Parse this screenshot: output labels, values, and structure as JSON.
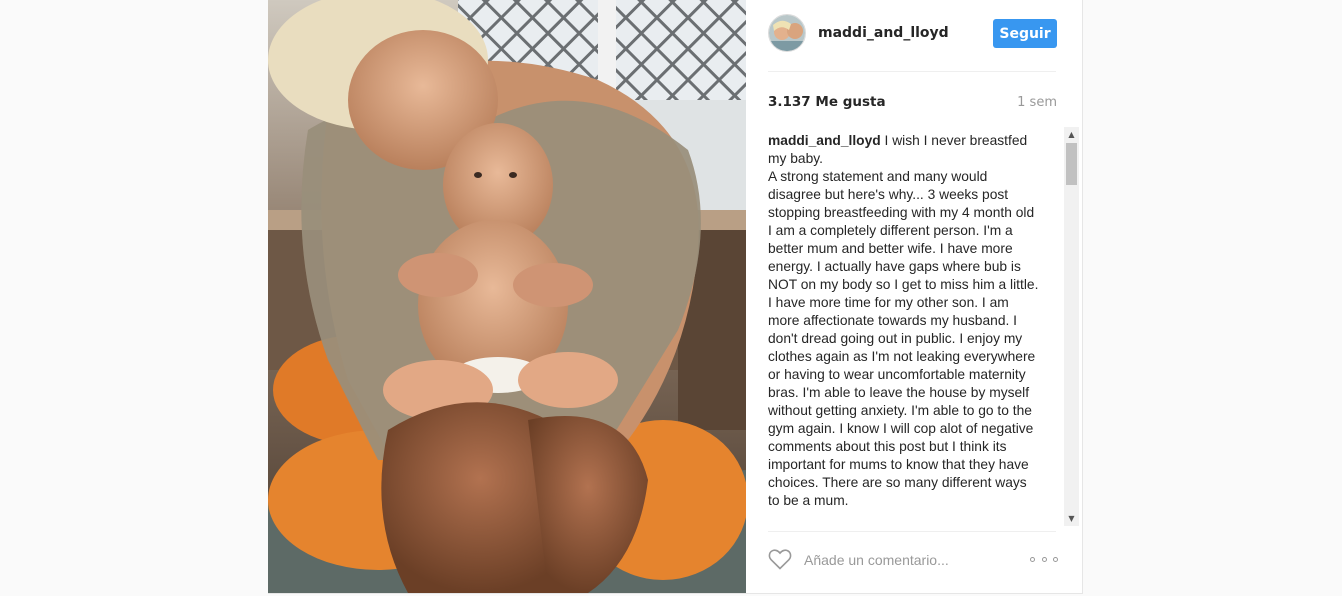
{
  "post": {
    "username": "maddi_and_lloyd",
    "follow_label": "Seguir",
    "likes": "3.137 Me gusta",
    "time": "1 sem",
    "caption_user": "maddi_and_lloyd",
    "caption_text": " I wish I never breastfed my baby.\nA strong statement and many would disagree but here's why... 3 weeks post stopping breastfeeding with my 4 month old I am a completely different person. I'm a better mum and better wife. I have more energy. I actually have gaps where bub is NOT on my body so I get to miss him a little. I have more time for my other son. I am more affectionate towards my husband. I don't dread going out in public. I enjoy my clothes again as I'm not leaking everywhere or having to wear uncomfortable maternity bras. I'm able to leave the house by myself without getting anxiety. I'm able to go to the gym again. I know I will cop alot of negative comments about this post but I think its important for mums to know that they have choices. There are so many different ways to be a mum.",
    "comment_placeholder": "Añade un comentario...",
    "icons": {
      "heart": "heart-icon",
      "more": "more-options-icon",
      "scroll_up": "▲",
      "scroll_down": "▼"
    },
    "colors": {
      "accent": "#3897f0",
      "text": "#262626",
      "muted": "#999999"
    }
  }
}
